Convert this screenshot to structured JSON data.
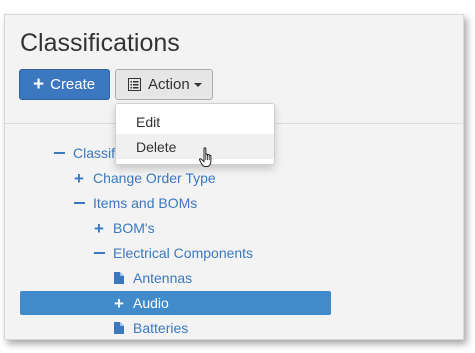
{
  "page": {
    "title": "Classifications"
  },
  "toolbar": {
    "create_label": "Create",
    "action_label": "Action"
  },
  "action_menu": {
    "items": [
      {
        "label": "Edit"
      },
      {
        "label": "Delete"
      }
    ],
    "hovered": "Delete"
  },
  "tree": {
    "items": [
      {
        "label": "Classifications",
        "state": "expanded",
        "level": 0
      },
      {
        "label": "Change Order Type",
        "state": "collapsed",
        "level": 1
      },
      {
        "label": "Items and BOMs",
        "state": "expanded",
        "level": 1
      },
      {
        "label": "BOM's",
        "state": "collapsed",
        "level": 2
      },
      {
        "label": "Electrical Components",
        "state": "expanded",
        "level": 2
      },
      {
        "label": "Antennas",
        "state": "leaf",
        "level": 3
      },
      {
        "label": "Audio",
        "state": "collapsed",
        "level": 3,
        "selected": true
      },
      {
        "label": "Batteries",
        "state": "leaf",
        "level": 3
      }
    ]
  },
  "colors": {
    "primary": "#3b78c0",
    "selected_row": "#428bca",
    "panel_bg": "#f3f3f3"
  }
}
